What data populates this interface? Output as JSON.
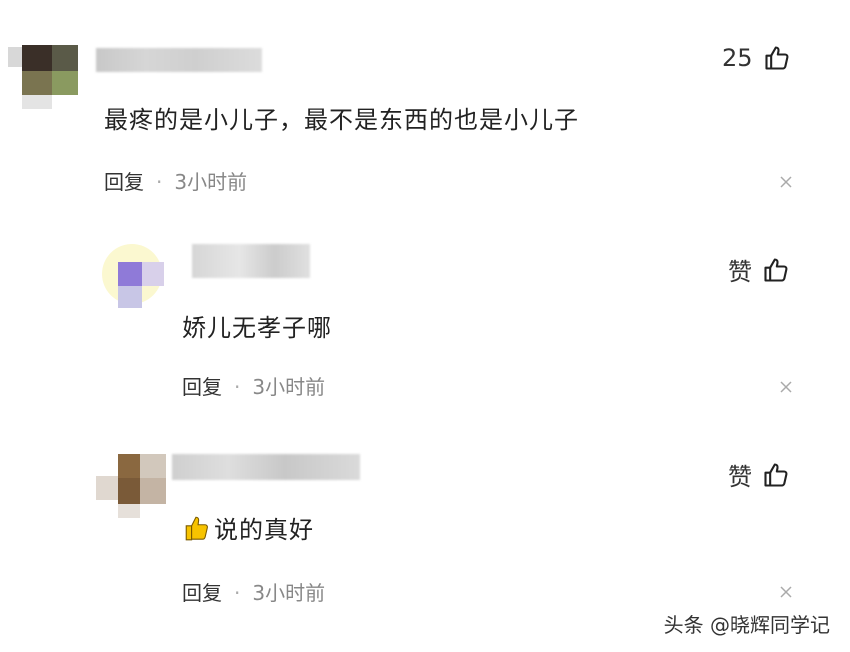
{
  "comments": [
    {
      "text": "最疼的是小儿子，最不是东西的也是小儿子",
      "likes": "25",
      "reply_label": "回复",
      "separator": "·",
      "time": "3小时前"
    },
    {
      "text": "娇儿无孝子哪",
      "likes": "赞",
      "reply_label": "回复",
      "separator": "·",
      "time": "3小时前"
    },
    {
      "text": "说的真好",
      "likes": "赞",
      "reply_label": "回复",
      "separator": "·",
      "time": "3小时前"
    }
  ],
  "watermark": "头条 @晓辉同学记",
  "icons": {
    "like": "thumbs-up-icon",
    "close": "close-icon",
    "emoji": "thumbs-up-emoji"
  },
  "colors": {
    "emoji_yellow": "#f7c300"
  }
}
